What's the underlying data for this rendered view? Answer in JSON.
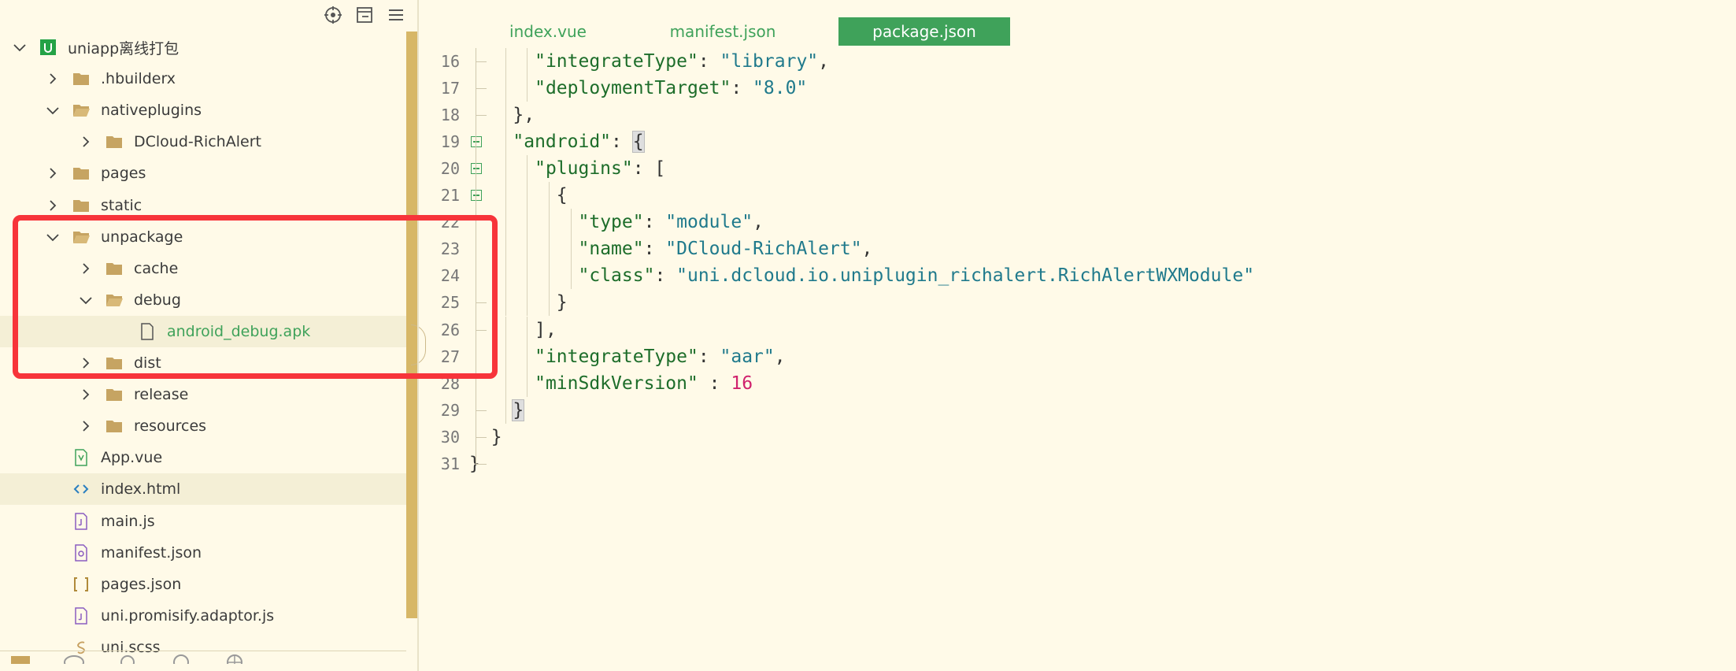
{
  "sidebar": {
    "toolbar": [
      {
        "name": "locate-icon"
      },
      {
        "name": "collapse-all-icon"
      },
      {
        "name": "menu-icon"
      }
    ],
    "tree": [
      {
        "label": "uniapp离线打包",
        "depth": 0,
        "type": "project",
        "expanded": true
      },
      {
        "label": ".hbuilderx",
        "depth": 1,
        "type": "folder",
        "expanded": false
      },
      {
        "label": "nativeplugins",
        "depth": 1,
        "type": "folder",
        "expanded": true
      },
      {
        "label": "DCloud-RichAlert",
        "depth": 2,
        "type": "folder",
        "expanded": false
      },
      {
        "label": "pages",
        "depth": 1,
        "type": "folder",
        "expanded": false
      },
      {
        "label": "static",
        "depth": 1,
        "type": "folder",
        "expanded": false
      },
      {
        "label": "unpackage",
        "depth": 1,
        "type": "folder",
        "expanded": true
      },
      {
        "label": "cache",
        "depth": 2,
        "type": "folder",
        "expanded": false
      },
      {
        "label": "debug",
        "depth": 2,
        "type": "folder",
        "expanded": true
      },
      {
        "label": "android_debug.apk",
        "depth": 3,
        "type": "file",
        "selected": true,
        "green": true
      },
      {
        "label": "dist",
        "depth": 2,
        "type": "folder",
        "expanded": false
      },
      {
        "label": "release",
        "depth": 2,
        "type": "folder",
        "expanded": false
      },
      {
        "label": "resources",
        "depth": 2,
        "type": "folder",
        "expanded": false
      },
      {
        "label": "App.vue",
        "depth": 1,
        "type": "vue"
      },
      {
        "label": "index.html",
        "depth": 1,
        "type": "html",
        "selected": true
      },
      {
        "label": "main.js",
        "depth": 1,
        "type": "js"
      },
      {
        "label": "manifest.json",
        "depth": 1,
        "type": "manifest"
      },
      {
        "label": "pages.json",
        "depth": 1,
        "type": "json"
      },
      {
        "label": "uni.promisify.adaptor.js",
        "depth": 1,
        "type": "js"
      },
      {
        "label": "uni.scss",
        "depth": 1,
        "type": "scss"
      }
    ]
  },
  "editor": {
    "tabs": [
      {
        "label": "index.vue",
        "active": false
      },
      {
        "label": "manifest.json",
        "active": false
      },
      {
        "label": "package.json",
        "active": true
      }
    ],
    "lines": [
      {
        "num": "16",
        "indent": 3,
        "tokens": [
          [
            "k",
            "\"integrateType\""
          ],
          [
            "p",
            ": "
          ],
          [
            "s",
            "\"library\""
          ],
          [
            "p",
            ","
          ]
        ]
      },
      {
        "num": "17",
        "indent": 3,
        "tokens": [
          [
            "k",
            "\"deploymentTarget\""
          ],
          [
            "p",
            ": "
          ],
          [
            "s",
            "\"8.0\""
          ]
        ]
      },
      {
        "num": "18",
        "indent": 2,
        "tokens": [
          [
            "p",
            "},"
          ]
        ]
      },
      {
        "num": "19",
        "indent": 2,
        "fold": true,
        "tokens": [
          [
            "k",
            "\"android\""
          ],
          [
            "p",
            ": "
          ],
          [
            "hl",
            "{"
          ]
        ]
      },
      {
        "num": "20",
        "indent": 3,
        "fold": true,
        "tokens": [
          [
            "k",
            "\"plugins\""
          ],
          [
            "p",
            ": ["
          ]
        ]
      },
      {
        "num": "21",
        "indent": 4,
        "fold": true,
        "tokens": [
          [
            "p",
            "{"
          ]
        ]
      },
      {
        "num": "22",
        "indent": 5,
        "tokens": [
          [
            "k",
            "\"type\""
          ],
          [
            "p",
            ": "
          ],
          [
            "s",
            "\"module\""
          ],
          [
            "p",
            ","
          ]
        ]
      },
      {
        "num": "23",
        "indent": 5,
        "tokens": [
          [
            "k",
            "\"name\""
          ],
          [
            "p",
            ": "
          ],
          [
            "s",
            "\"DCloud-RichAlert\""
          ],
          [
            "p",
            ","
          ]
        ]
      },
      {
        "num": "24",
        "indent": 5,
        "tokens": [
          [
            "k",
            "\"class\""
          ],
          [
            "p",
            ": "
          ],
          [
            "s",
            "\"uni.dcloud.io.uniplugin_richalert.RichAlertWXModule\""
          ]
        ]
      },
      {
        "num": "25",
        "indent": 4,
        "tokens": [
          [
            "p",
            "}"
          ]
        ]
      },
      {
        "num": "26",
        "indent": 3,
        "tokens": [
          [
            "p",
            "],"
          ]
        ]
      },
      {
        "num": "27",
        "indent": 3,
        "tokens": [
          [
            "k",
            "\"integrateType\""
          ],
          [
            "p",
            ": "
          ],
          [
            "s",
            "\"aar\""
          ],
          [
            "p",
            ","
          ]
        ]
      },
      {
        "num": "28",
        "indent": 3,
        "tokens": [
          [
            "k",
            "\"minSdkVersion\""
          ],
          [
            "p",
            " : "
          ],
          [
            "n",
            "16"
          ]
        ]
      },
      {
        "num": "29",
        "indent": 2,
        "tokens": [
          [
            "hl",
            "}"
          ]
        ]
      },
      {
        "num": "30",
        "indent": 1,
        "tokens": [
          [
            "p",
            "}"
          ]
        ]
      },
      {
        "num": "31",
        "indent": 0,
        "tokens": [
          [
            "p",
            "}"
          ]
        ]
      }
    ]
  },
  "colors": {
    "accent": "#3fa25a",
    "annotation": "#f7343a",
    "background": "#fffae8"
  }
}
